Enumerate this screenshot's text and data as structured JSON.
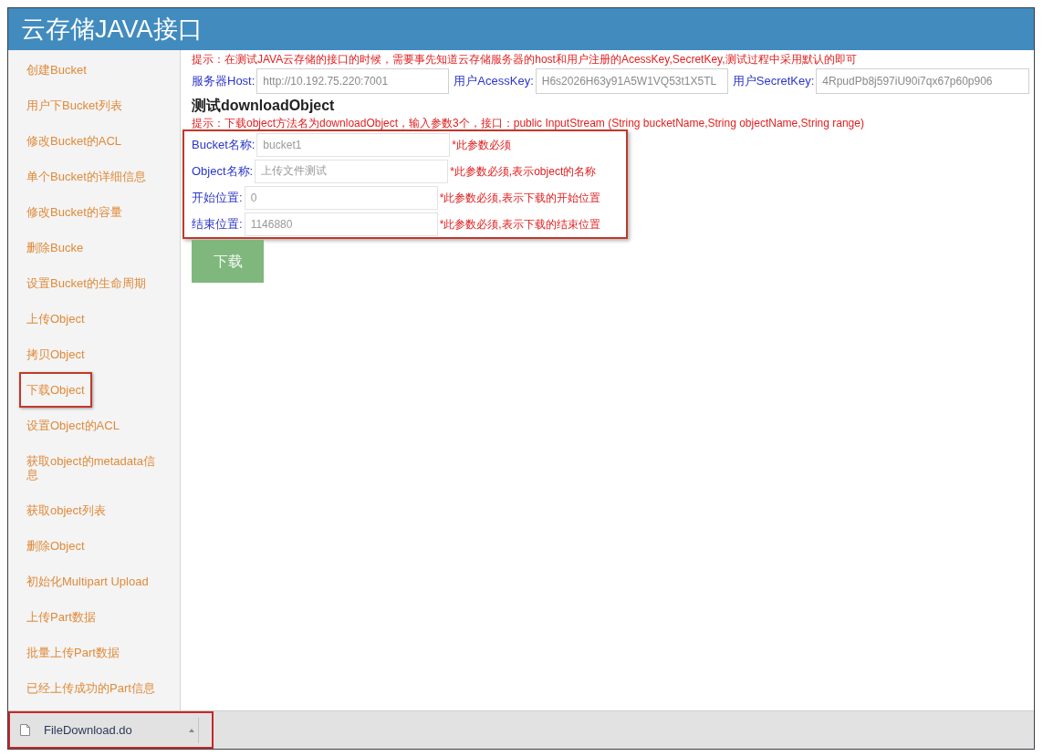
{
  "header": {
    "title": "云存储JAVA接口"
  },
  "sidebar": {
    "items": [
      {
        "label": "创建Bucket",
        "selected": false
      },
      {
        "label": "用户下Bucket列表",
        "selected": false
      },
      {
        "label": "修改Bucket的ACL",
        "selected": false
      },
      {
        "label": "单个Bucket的详细信息",
        "selected": false
      },
      {
        "label": "修改Bucket的容量",
        "selected": false
      },
      {
        "label": "删除Bucke",
        "selected": false
      },
      {
        "label": "设置Bucket的生命周期",
        "selected": false
      },
      {
        "label": "上传Object",
        "selected": false
      },
      {
        "label": "拷贝Object",
        "selected": false
      },
      {
        "label": "下载Object",
        "selected": true
      },
      {
        "label": "设置Object的ACL",
        "selected": false
      },
      {
        "label": "获取object的metadata信息",
        "selected": false
      },
      {
        "label": "获取object列表",
        "selected": false
      },
      {
        "label": "删除Object",
        "selected": false
      },
      {
        "label": "初始化Multipart Upload",
        "selected": false
      },
      {
        "label": "上传Part数据",
        "selected": false
      },
      {
        "label": "批量上传Part数据",
        "selected": false
      },
      {
        "label": "已经上传成功的Part信息",
        "selected": false
      }
    ]
  },
  "main": {
    "notice": "提示：在测试JAVA云存储的接口的时候，需要事先知道云存储服务器的host和用户注册的AcessKey,SecretKey,测试过程中采用默认的即可",
    "server_fields": [
      {
        "label": "服务器Host:",
        "value": "http://10.192.75.220:7001"
      },
      {
        "label": "用户AcessKey:",
        "value": "H6s2026H63y91A5W1VQ53t1X5TL"
      },
      {
        "label": "用户SecretKey:",
        "value": "4RpudPb8j597iU90i7qx67p60p906"
      }
    ],
    "section_title": "测试downloadObject",
    "section_notice": "提示：下载object方法名为downloadObject，输入参数3个，接口：public InputStream (String bucketName,String objectName,String range)",
    "form": {
      "highlighted": true,
      "fields": [
        {
          "label": "Bucket名称:",
          "value": "bucket1",
          "note": "*此参数必须"
        },
        {
          "label": "Object名称:",
          "value": "上传文件测试",
          "note": "*此参数必须,表示object的名称"
        },
        {
          "label": "开始位置:",
          "value": "0",
          "note": "*此参数必须,表示下载的开始位置"
        },
        {
          "label": "结束位置:",
          "value": "1146880",
          "note": "*此参数必须,表示下载的结束位置"
        }
      ]
    },
    "submit_button": "下载"
  },
  "download_bar": {
    "items": [
      {
        "file_name": "FileDownload.do",
        "highlighted": true
      }
    ]
  }
}
